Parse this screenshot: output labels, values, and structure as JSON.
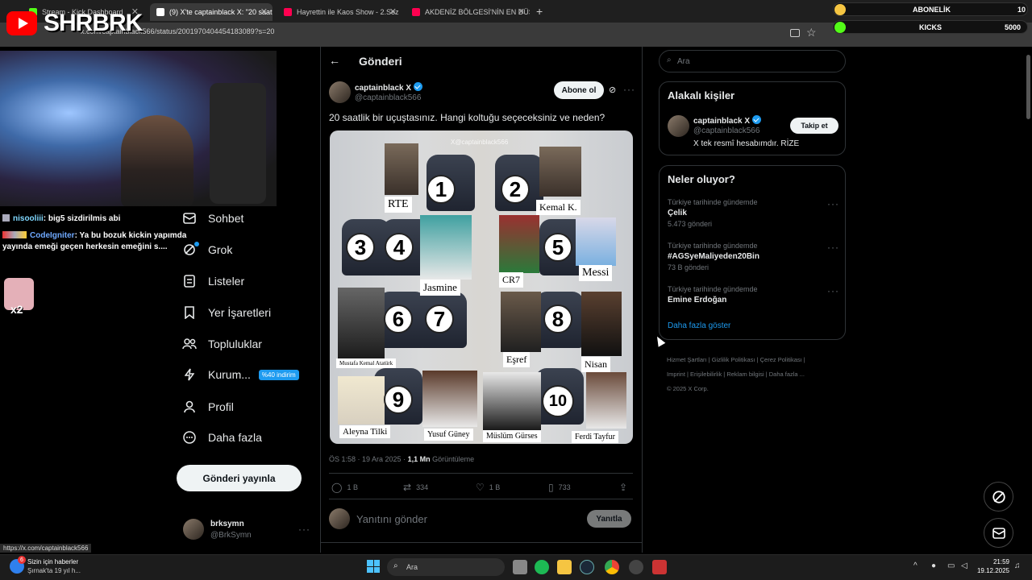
{
  "browser": {
    "tabs": [
      {
        "label": "Stream - Kick Dashboard",
        "active": false,
        "color": "#53fc18"
      },
      {
        "label": "(9) X'te captainblack X: \"20 saat",
        "active": true,
        "color": "#ffffff"
      },
      {
        "label": "Hayrettin ile Kaos Show - 2.Sez",
        "active": false,
        "color": "#ff0050"
      },
      {
        "label": "AKDENİZ BÖLGESİ'NİN EN DÜŞ",
        "active": false,
        "color": "#ff0050"
      }
    ],
    "url": "x.com/captainblack566/status/2001970404454183089?s=20",
    "status_url": "https://x.com/captainblack566"
  },
  "overlay": {
    "logo_text": "SHRBRK",
    "abonelik_label": "ABONELİK",
    "abonelik_value": "10",
    "kicks_label": "KICKS",
    "kicks_value": "5000",
    "chat": [
      {
        "user": "nisooliii",
        "text": ": big5 sizdirilmis abi"
      },
      {
        "user": "CodeIgniter",
        "text": ": Ya bu bozuk kickin yapımda yayında emeği geçen herkesin emeğini s...."
      }
    ],
    "multiplier": "x2"
  },
  "nav": {
    "items": [
      {
        "label": "Sohbet",
        "icon": "mail-icon"
      },
      {
        "label": "Grok",
        "icon": "grok-icon"
      },
      {
        "label": "Listeler",
        "icon": "list-icon"
      },
      {
        "label": "Yer İşaretleri",
        "icon": "bookmark-icon"
      },
      {
        "label": "Topluluklar",
        "icon": "communities-icon"
      },
      {
        "label": "Kurum...",
        "icon": "lightning-icon",
        "badge": "%40 indirim"
      },
      {
        "label": "Profil",
        "icon": "profile-icon"
      },
      {
        "label": "Daha fazla",
        "icon": "more-icon"
      }
    ],
    "post_button": "Gönderi yayınla",
    "account": {
      "name": "brksymn",
      "handle": "@BrkSymn"
    }
  },
  "post": {
    "header": "Gönderi",
    "author": "captainblack X",
    "handle": "@captainblack566",
    "subscribe": "Abone ol",
    "text": "20 saatlik bir uçuştasınız. Hangi koltuğu seçeceksiniz ve neden?",
    "image": {
      "watermark": "X@captainblack566",
      "labels": [
        "RTE",
        "Kemal K.",
        "Jasmine",
        "CR7",
        "Messi",
        "Mustafa Kemal Atatürk",
        "Eşref",
        "Nisan",
        "Aleyna Tilki",
        "Yusuf Güney",
        "Müslüm Gürses",
        "Ferdi Tayfur"
      ],
      "numbers": [
        "1",
        "2",
        "3",
        "4",
        "5",
        "6",
        "7",
        "8",
        "9",
        "10"
      ]
    },
    "time": "ÖS 1:58 · 19 Ara 2025 · ",
    "views_num": "1,1 Mn",
    "views_label": " Görüntüleme",
    "stats": {
      "replies": "1 B",
      "reposts": "334",
      "likes": "1 B",
      "bookmarks": "733"
    },
    "reply_placeholder": "Yanıtını gönder",
    "reply_button": "Yanıtla"
  },
  "sidebar": {
    "search_placeholder": "Ara",
    "related_title": "Alakalı kişiler",
    "related": {
      "name": "captainblack X",
      "handle": "@captainblack566",
      "bio": "X tek resmî hesabımdır. RİZE",
      "follow": "Takip et"
    },
    "trends_title": "Neler oluyor?",
    "trends": [
      {
        "meta": "Türkiye tarihinde gündemde",
        "name": "Çelik",
        "count": "5.473 gönderi"
      },
      {
        "meta": "Türkiye tarihinde gündemde",
        "name": "#AGSyeMaliyeden20Bin",
        "count": "73 B gönderi"
      },
      {
        "meta": "Türkiye tarihinde gündemde",
        "name": "Emine Erdoğan",
        "count": ""
      }
    ],
    "show_more": "Daha fazla göster",
    "footer": [
      "Hizmet Şartları",
      "Gizlilik Politikası",
      "Çerez Politikası",
      "Imprint",
      "Erişilebilirlik",
      "Reklam bilgisi",
      "Daha fazla ...",
      "© 2025 X Corp."
    ]
  },
  "taskbar": {
    "notification_count": "6",
    "news_title": "Sizin için haberler",
    "news_sub": "Şırnak'ta 19 yıl h...",
    "search": "Ara",
    "time": "21:59",
    "date": "19.12.2025"
  },
  "colors": {
    "accent": "#1d9bf0",
    "background": "#000000",
    "border": "#2f3336"
  }
}
